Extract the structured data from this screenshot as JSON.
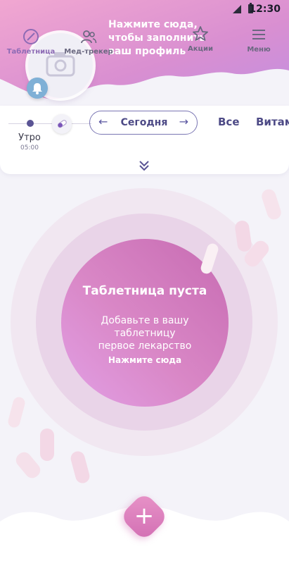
{
  "status": {
    "time": "12:30"
  },
  "header": {
    "profile_prompt": "Нажмите сюда,\nчтобы заполнить\nваш профиль"
  },
  "schedule": {
    "time_of_day": "Утро",
    "time": "05:00",
    "date_label": "Сегодня",
    "prev_arrow": "←",
    "next_arrow": "→"
  },
  "filters": [
    {
      "label": "Все"
    },
    {
      "label": "Витам"
    }
  ],
  "empty_state": {
    "title": "Таблетница пуста",
    "subtitle": "Добавьте в вашу таблетницу\nпервое лекарство",
    "action": "Нажмите сюда"
  },
  "fab": {
    "label": "+"
  },
  "nav": [
    {
      "label": "Таблетница",
      "icon": "pill-icon",
      "active": true
    },
    {
      "label": "Мед-трекер",
      "icon": "people-icon",
      "active": false
    },
    {
      "label": "Акции",
      "icon": "star-icon",
      "active": false
    },
    {
      "label": "Меню",
      "icon": "menu-icon",
      "active": false
    }
  ],
  "colors": {
    "accent": "#5a5494",
    "brand_pink": "#d26eb3",
    "active_nav": "#8d6bb5"
  }
}
